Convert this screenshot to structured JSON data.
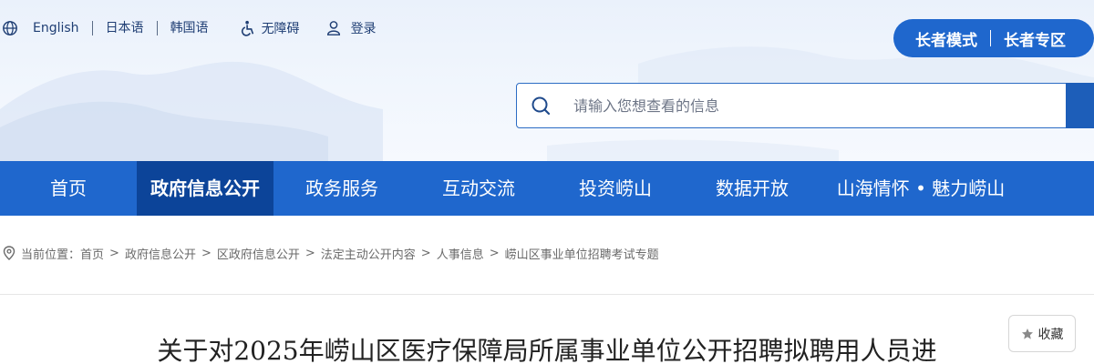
{
  "languages": [
    "English",
    "日本语",
    "韩国语"
  ],
  "accessibility_label": "无障碍",
  "login_label": "登录",
  "elder": {
    "mode_label": "长者模式",
    "zone_label": "长者专区"
  },
  "search": {
    "placeholder": "请输入您想查看的信息"
  },
  "nav": {
    "active_index": 1,
    "items": [
      "首页",
      "政府信息公开",
      "政务服务",
      "互动交流",
      "投资崂山",
      "数据开放",
      "山海情怀 • 魅力崂山"
    ]
  },
  "breadcrumb": {
    "label": "当前位置：",
    "items": [
      "首页",
      "政府信息公开",
      "区政府信息公开",
      "法定主动公开内容",
      "人事信息",
      "崂山区事业单位招聘考试专题"
    ]
  },
  "favorite_label": "收藏",
  "article": {
    "title": "关于对2025年崂山区医疗保障局所属事业单位公开招聘拟聘用人员进"
  },
  "colors": {
    "primary": "#1f67cd",
    "nav_active": "#0c4499",
    "search_button": "#1d5eb9"
  },
  "icons": [
    "globe-icon",
    "wheelchair-icon",
    "user-icon",
    "search-icon",
    "location-pin-icon",
    "star-icon"
  ]
}
